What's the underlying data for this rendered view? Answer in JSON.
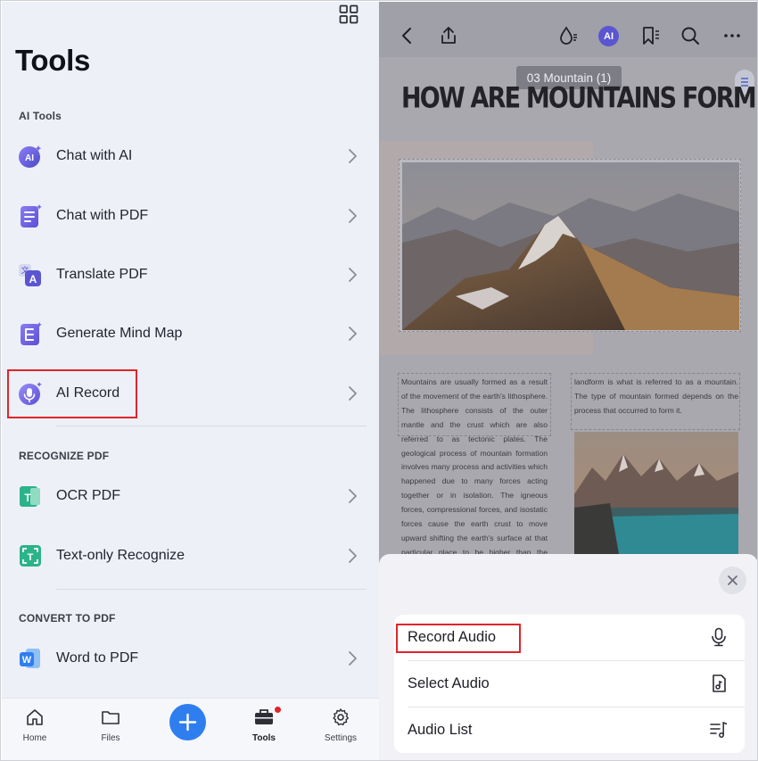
{
  "left_panel": {
    "title": "Tools",
    "sections": [
      {
        "label": "AI Tools",
        "items": [
          {
            "label": "Chat with AI",
            "icon": "ai-chat-icon"
          },
          {
            "label": "Chat with PDF",
            "icon": "pdf-chat-icon"
          },
          {
            "label": "Translate PDF",
            "icon": "translate-icon"
          },
          {
            "label": "Generate Mind Map",
            "icon": "mind-map-icon"
          },
          {
            "label": "AI Record",
            "icon": "ai-record-icon"
          }
        ]
      },
      {
        "label": "RECOGNIZE PDF",
        "items": [
          {
            "label": "OCR PDF",
            "icon": "ocr-icon"
          },
          {
            "label": "Text-only Recognize",
            "icon": "text-recognize-icon"
          }
        ]
      },
      {
        "label": "CONVERT TO PDF",
        "items": [
          {
            "label": "Word to PDF",
            "icon": "word-icon"
          }
        ]
      }
    ],
    "bottom_nav": [
      {
        "label": "Home",
        "icon": "home-icon"
      },
      {
        "label": "Files",
        "icon": "folder-icon"
      },
      {
        "label": "",
        "icon": "plus-icon"
      },
      {
        "label": "Tools",
        "icon": "toolbox-icon",
        "active": true
      },
      {
        "label": "Settings",
        "icon": "gear-icon"
      }
    ]
  },
  "right_panel": {
    "toolbar": {
      "ai_label": "AI"
    },
    "document": {
      "tooltip": "03 Mountain (1)",
      "headline": "HOW ARE MOUNTAINS FORMED?",
      "col1_text": "Mountains are usually formed as a result of the movement of the earth's lithosphere. The lithosphere consists of the outer mantle and the crust which are also referred to as tectonic plates. The geological process of mountain formation involves many process and activities which happened due to many forces acting together or in isolation. The igneous forces, compressional forces, and isostatic forces cause the earth crust to move upward shifting the earth's surface at that particular place to be higher than the surrounding environment. The resultant",
      "col2_text": "landform is what is referred to as a mountain. The type of mountain formed depends on the process that occurred to form it."
    },
    "sheet": {
      "items": [
        {
          "label": "Record Audio",
          "icon": "microphone-icon"
        },
        {
          "label": "Select Audio",
          "icon": "audio-file-icon"
        },
        {
          "label": "Audio List",
          "icon": "playlist-icon"
        }
      ]
    }
  },
  "colors": {
    "accent": "#2f7ef0",
    "highlight": "#e0242b",
    "ai_purple": "#5b55d2"
  }
}
